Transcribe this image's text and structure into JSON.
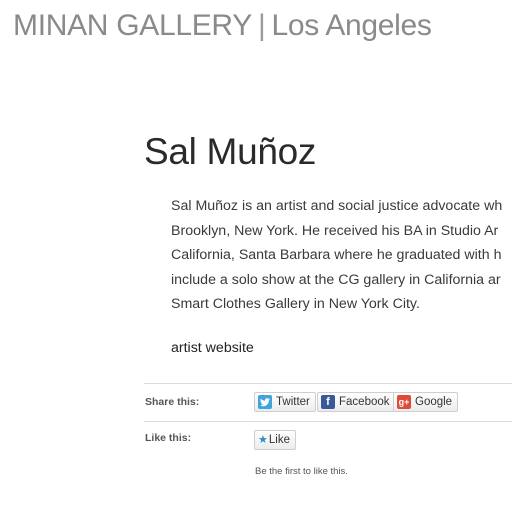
{
  "header": {
    "gallery_name": "MINAN GALLERY",
    "separator": "|",
    "location": "Los Angeles"
  },
  "page": {
    "title": "Sal Muñoz",
    "bio_lines": [
      "Sal Muñoz is an artist and social justice advocate wh",
      "Brooklyn, New York. He received his BA in Studio Ar",
      "California, Santa Barbara where he graduated with h",
      "include a solo show at the CG gallery in California ar",
      "Smart Clothes Gallery in New York City."
    ],
    "artist_link": "artist website"
  },
  "share": {
    "label": "Share this:",
    "buttons": [
      {
        "label": "Twitter",
        "icon": "twitter-icon",
        "color": "#3fa3dc"
      },
      {
        "label": "Facebook",
        "icon": "facebook-icon",
        "color": "#3b5998"
      },
      {
        "label": "Google",
        "icon": "google-plus-icon",
        "color": "#dd4b39"
      }
    ]
  },
  "like": {
    "label": "Like this:",
    "button_label": "Like",
    "first_text": "Be the first to like this."
  }
}
